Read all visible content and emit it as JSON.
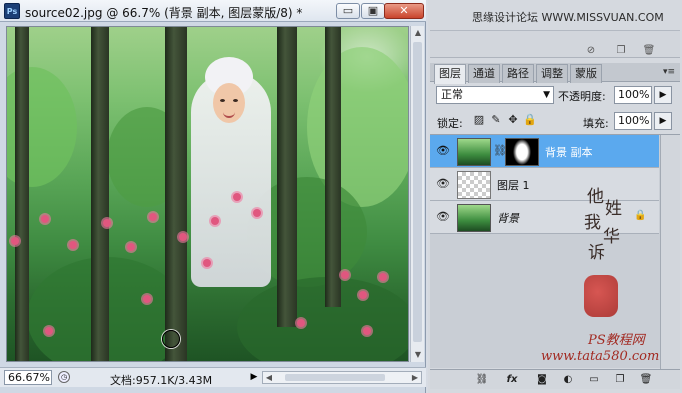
{
  "document": {
    "title": "source02.jpg @ 66.7% (背景 副本, 图层蒙版/8) *",
    "app_icon": "Ps",
    "window_buttons": {
      "minimize": "▭",
      "restore": "▣",
      "close": "✕"
    }
  },
  "statusbar": {
    "zoom": "66.67%",
    "doc_size": "文档:957.1K/3.43M",
    "menu_arrow": "▶"
  },
  "watermark": {
    "site": "思缘设计论坛 WWW.MISSVUAN.COM",
    "calligraphy": [
      "他",
      "姓",
      "我",
      "华",
      "诉"
    ],
    "ps_site": "PS教程网",
    "ps_url": "www.tata580.com"
  },
  "layers_panel": {
    "tabs": [
      {
        "label": "图层",
        "active": true
      },
      {
        "label": "通道",
        "active": false
      },
      {
        "label": "路径",
        "active": false
      },
      {
        "label": "调整",
        "active": false
      },
      {
        "label": "蒙版",
        "active": false
      }
    ],
    "blend_mode": "正常",
    "opacity_label": "不透明度:",
    "opacity_value": "100%",
    "lock_label": "锁定:",
    "fill_label": "填充:",
    "fill_value": "100%",
    "layers": [
      {
        "name": "背景 副本",
        "selected": true,
        "has_mask": true
      },
      {
        "name": "图层 1",
        "selected": false,
        "has_mask": false
      },
      {
        "name": "背景",
        "selected": false,
        "has_mask": false,
        "locked": true
      }
    ]
  },
  "icons": {
    "eye": "visibility-eye-icon",
    "link": "link-icon",
    "fx": "fx",
    "new_layer": "new-layer-icon",
    "trash": "trash-icon"
  }
}
